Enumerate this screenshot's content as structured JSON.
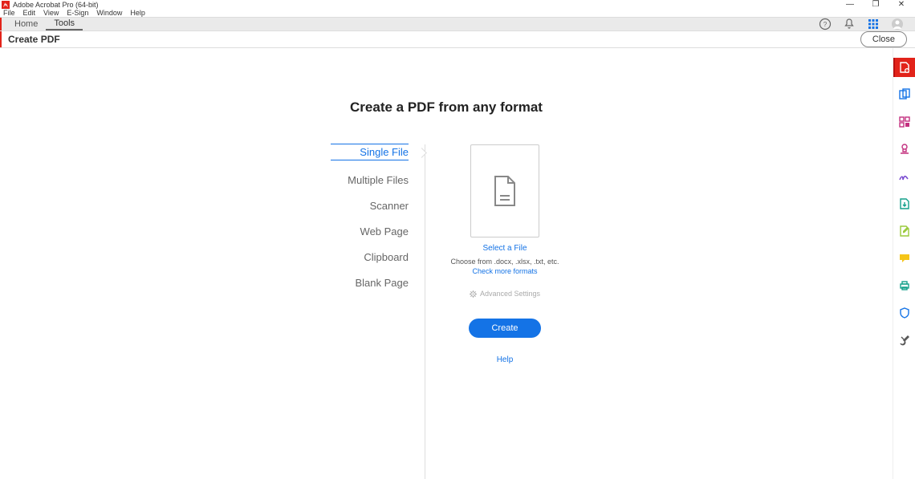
{
  "titlebar": {
    "title": "Adobe Acrobat Pro (64-bit)"
  },
  "menubar": [
    "File",
    "Edit",
    "View",
    "E-Sign",
    "Window",
    "Help"
  ],
  "tabbar": {
    "tabs": [
      {
        "label": "Home",
        "active": false
      },
      {
        "label": "Tools",
        "active": true
      }
    ]
  },
  "subheader": {
    "title": "Create PDF",
    "close": "Close"
  },
  "main": {
    "title": "Create a PDF from any format",
    "options": [
      {
        "label": "Single File",
        "active": true
      },
      {
        "label": "Multiple Files",
        "active": false
      },
      {
        "label": "Scanner",
        "active": false
      },
      {
        "label": "Web Page",
        "active": false
      },
      {
        "label": "Clipboard",
        "active": false
      },
      {
        "label": "Blank Page",
        "active": false
      }
    ],
    "select_file": "Select a File",
    "choose_from": "Choose from .docx, .xlsx, .txt, etc.",
    "check_more": "Check more formats",
    "advanced": "Advanced Settings",
    "create": "Create",
    "help": "Help"
  }
}
